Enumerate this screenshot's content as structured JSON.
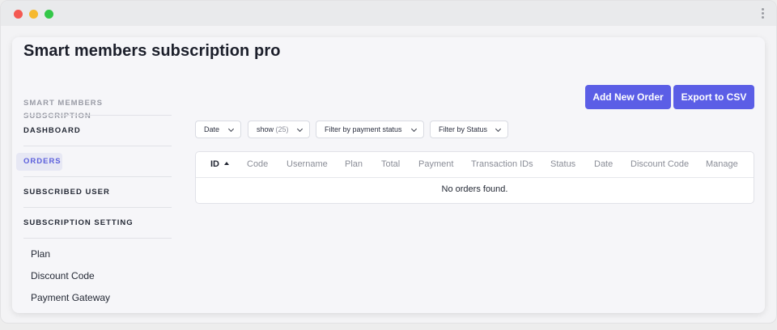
{
  "app": {
    "title": "Smart members subscription pro"
  },
  "sidebar": {
    "heading": "SMART MEMBERS SUBSCRIPTION",
    "items": [
      {
        "label": "DASHBOARD"
      },
      {
        "label": "ORDERS"
      },
      {
        "label": "SUBSCRIBED USER"
      },
      {
        "label": "SUBSCRIPTION SETTING"
      }
    ],
    "subitems": [
      {
        "label": "Plan"
      },
      {
        "label": "Discount Code"
      },
      {
        "label": "Payment Gateway"
      }
    ]
  },
  "toolbar": {
    "add_label": "Add New Order",
    "export_label": "Export to CSV"
  },
  "filters": {
    "date": "Date",
    "show_prefix": "show",
    "show_count": "(25)",
    "payment_status": "Filter by payment status",
    "status": "Filter by Status"
  },
  "table": {
    "columns": [
      "ID",
      "Code",
      "Username",
      "Plan",
      "Total",
      "Payment",
      "Transaction IDs",
      "Status",
      "Date",
      "Discount Code",
      "Manage"
    ],
    "empty_message": "No orders found."
  },
  "colors": {
    "accent": "#5b5ee6",
    "active_nav": "#5b5fdc",
    "window_red": "#f45952",
    "window_yellow": "#f6b92f",
    "window_green": "#33c748"
  },
  "icons": {
    "sort": "sort-ascending-icon",
    "dropdown": "chevron-down-icon",
    "menu": "kebab-menu-icon"
  }
}
